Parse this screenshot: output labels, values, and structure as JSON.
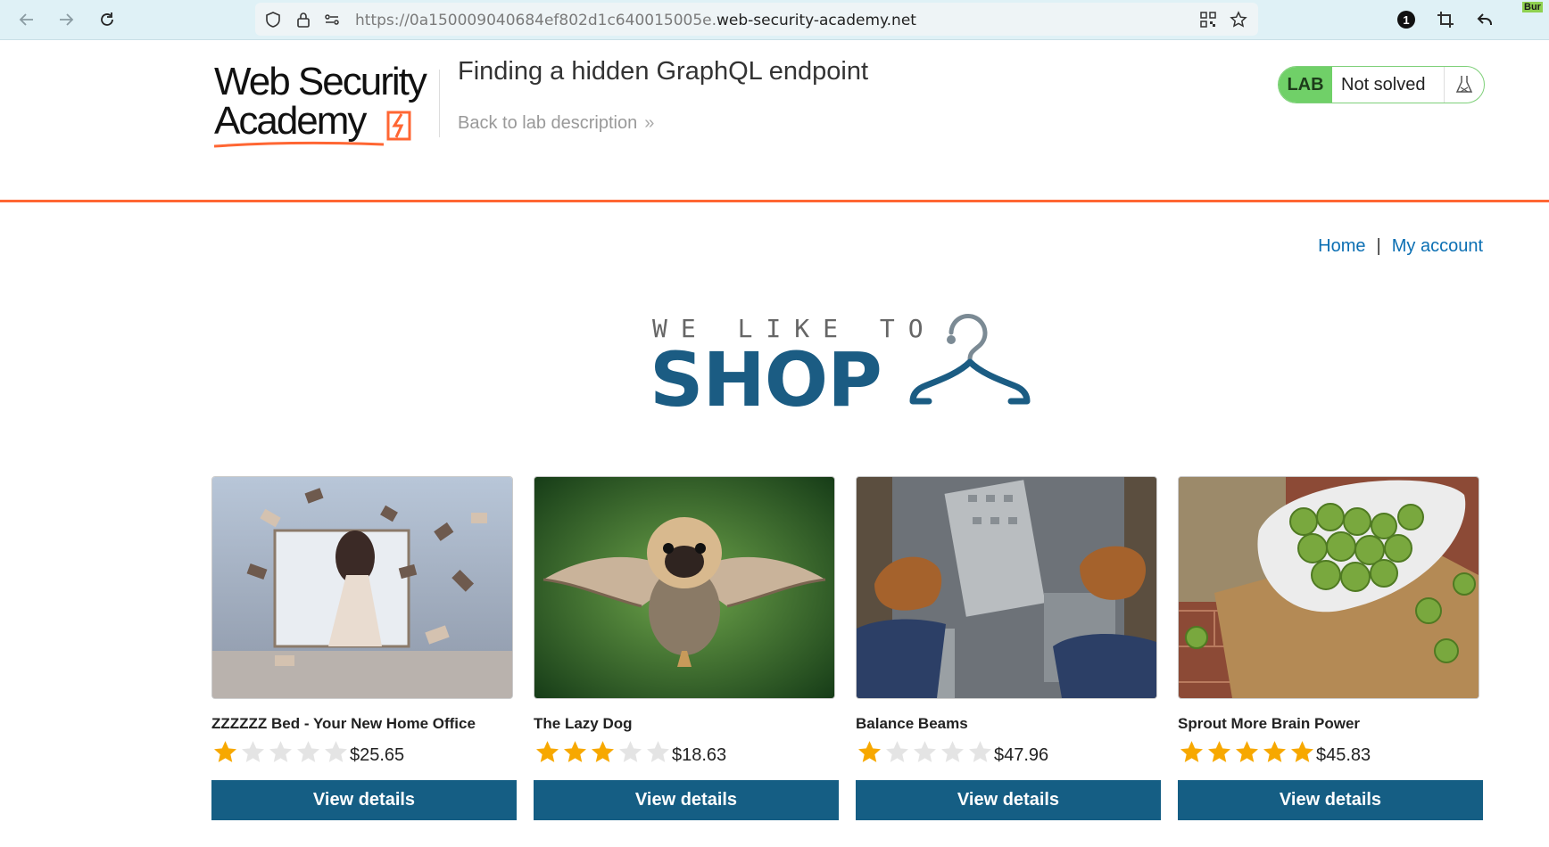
{
  "browser": {
    "url_prefix": "https://0a150009040684ef802d1c640015005e.",
    "url_host": "web-security-academy.net",
    "extension_badge": "1",
    "burp_label": "Bur"
  },
  "lab": {
    "logo_line1": "Web Security",
    "logo_line2": "Academy",
    "title": "Finding a hidden GraphQL endpoint",
    "back_link": "Back to lab description",
    "badge_label": "LAB",
    "status": "Not solved"
  },
  "nav": {
    "home": "Home",
    "separator": "|",
    "account": "My account"
  },
  "banner": {
    "tagline": "WE LIKE TO",
    "headline": "SHOP"
  },
  "products": [
    {
      "name": "ZZZZZZ Bed - Your New Home Office",
      "rating": 1,
      "price": "$25.65",
      "button": "View details",
      "image": "woman-with-flying-books"
    },
    {
      "name": "The Lazy Dog",
      "rating": 3,
      "price": "$18.63",
      "button": "View details",
      "image": "pug-with-owl-wings"
    },
    {
      "name": "Balance Beams",
      "rating": 1,
      "price": "$47.96",
      "button": "View details",
      "image": "feet-over-city"
    },
    {
      "name": "Sprout More Brain Power",
      "rating": 5,
      "price": "$45.83",
      "button": "View details",
      "image": "bowl-of-sprouts"
    }
  ],
  "colors": {
    "brand_orange": "#ff6633",
    "button_blue": "#155e84",
    "link_blue": "#0b6fb3",
    "star_gold": "#f7a800",
    "lab_green": "#70d068"
  }
}
